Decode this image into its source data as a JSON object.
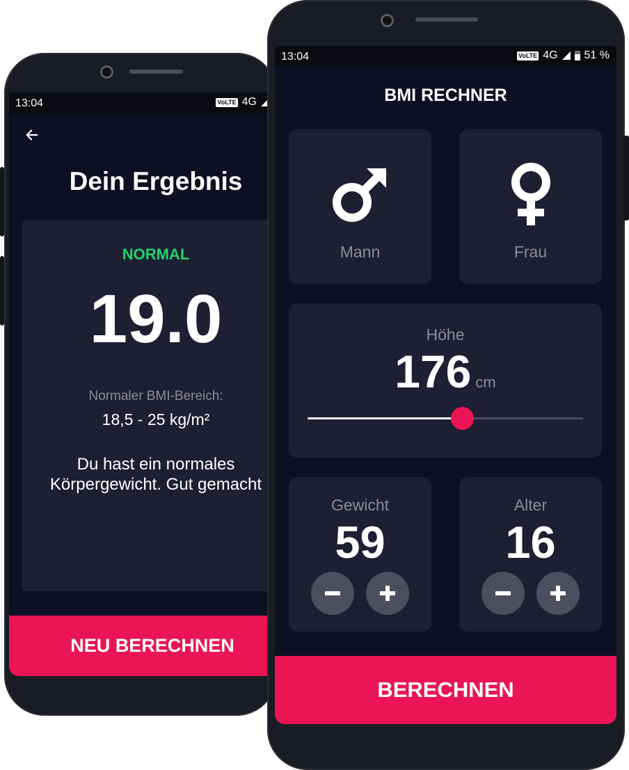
{
  "result_screen": {
    "status_time": "13:04",
    "status_network": "4G",
    "back_icon": "arrow-left-icon",
    "title": "Dein Ergebnis",
    "category": "NORMAL",
    "bmi": "19.0",
    "range_label": "Normaler BMI-Bereich:",
    "range_value": "18,5 - 25 kg/m²",
    "message": "Du hast ein normales\nKörpergewicht. Gut gemacht",
    "recalc_label": "NEU BERECHNEN",
    "colors": {
      "category": "#22d26b",
      "button": "#eb1555"
    }
  },
  "calculator_screen": {
    "status_time": "13:04",
    "status_network": "4G",
    "status_battery": "51 %",
    "title": "BMI RECHNER",
    "gender": {
      "male": {
        "label": "Mann",
        "icon": "male-symbol-icon"
      },
      "female": {
        "label": "Frau",
        "icon": "female-symbol-icon"
      }
    },
    "height": {
      "label": "Höhe",
      "value": "176",
      "unit": "cm",
      "slider_fraction": 0.56
    },
    "weight": {
      "label": "Gewicht",
      "value": "59"
    },
    "age": {
      "label": "Alter",
      "value": "16"
    },
    "minus_icon": "minus-icon",
    "plus_icon": "plus-icon",
    "calculate_label": "BERECHNEN",
    "colors": {
      "background": "#0d1022",
      "card": "#1d1f33",
      "accent": "#eb1555"
    }
  }
}
